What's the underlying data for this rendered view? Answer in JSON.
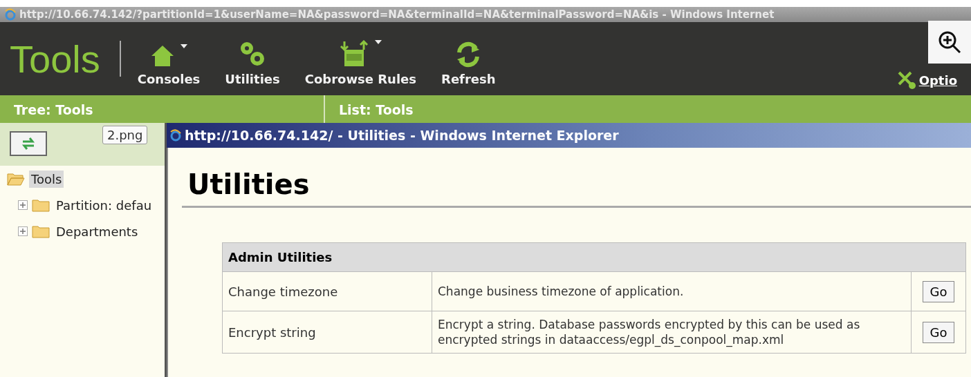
{
  "browser_title": "http://10.66.74.142/?partitionId=1&userName=NA&password=NA&terminalId=NA&terminalPassword=NA&is - Windows Internet",
  "app": {
    "title": "Tools",
    "toolbar": [
      {
        "kind": "house",
        "label": "Consoles",
        "dropdown": true
      },
      {
        "kind": "gears",
        "label": "Utilities",
        "dropdown": false
      },
      {
        "kind": "xml",
        "label": "Cobrowse Rules",
        "dropdown": true
      },
      {
        "kind": "refresh",
        "label": "Refresh",
        "dropdown": false
      }
    ],
    "options": "Optio"
  },
  "tree_header": "Tree: Tools",
  "list_header": "List: Tools",
  "tooltip": "2.png",
  "tree": [
    {
      "label": "Tools",
      "selected": true,
      "expanded": true,
      "children": [
        {
          "label": "Partition: defau",
          "selected": false,
          "expanded": false
        },
        {
          "label": "Departments",
          "selected": false,
          "expanded": false
        }
      ]
    }
  ],
  "popup": {
    "title": "http://10.66.74.142/ - Utilities - Windows Internet Explorer",
    "heading": "Utilities",
    "table": {
      "caption": "Admin Utilities",
      "rows": [
        {
          "name": "Change timezone",
          "description": "Change business timezone of application.",
          "action": "Go"
        },
        {
          "name": "Encrypt string",
          "description": "Encrypt a string. Database passwords encrypted by this can be used as encrypted strings in dataaccess/egpl_ds_conpool_map.xml",
          "action": "Go"
        }
      ]
    }
  }
}
